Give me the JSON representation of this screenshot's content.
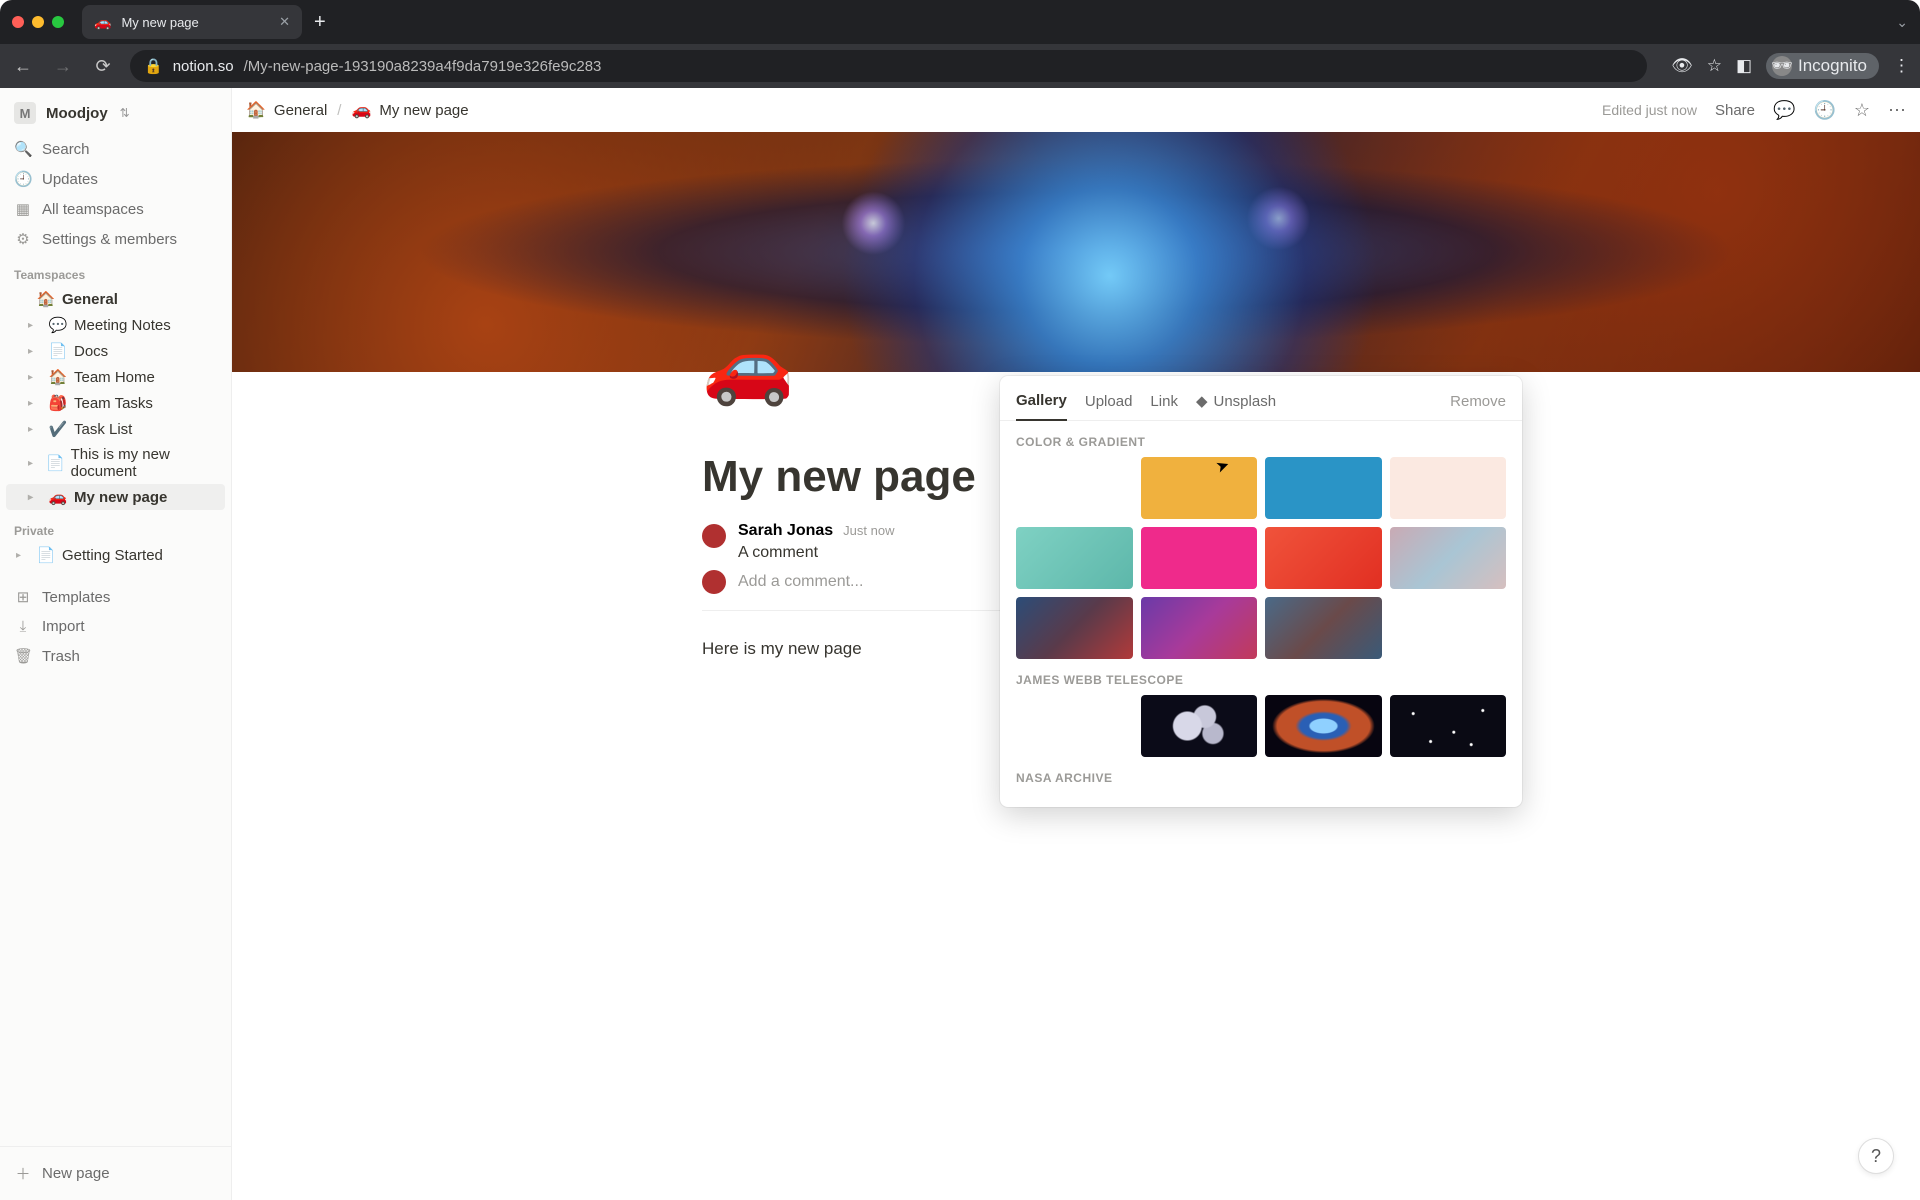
{
  "browser": {
    "tab_title": "My new page",
    "tab_icon": "🚗",
    "url_domain": "notion.so",
    "url_path": "/My-new-page-193190a8239a4f9da7919e326fe9c283",
    "incognito_label": "Incognito"
  },
  "workspace": {
    "initial": "M",
    "name": "Moodjoy"
  },
  "sidebar": {
    "top": [
      {
        "label": "Search",
        "icon": "🔍"
      },
      {
        "label": "Updates",
        "icon": "🕘"
      },
      {
        "label": "All teamspaces",
        "icon": "▦"
      },
      {
        "label": "Settings & members",
        "icon": "⚙"
      }
    ],
    "section_teamspaces": "Teamspaces",
    "general_label": "General",
    "general_emoji": "🏠",
    "pages": [
      {
        "emoji": "💬",
        "label": "Meeting Notes"
      },
      {
        "emoji": "📄",
        "label": "Docs"
      },
      {
        "emoji": "🏠",
        "label": "Team Home"
      },
      {
        "emoji": "🎒",
        "label": "Team Tasks"
      },
      {
        "emoji": "✔️",
        "label": "Task List"
      },
      {
        "emoji": "📄",
        "label": "This is my new document"
      },
      {
        "emoji": "🚗",
        "label": "My new page",
        "active": true
      }
    ],
    "section_private": "Private",
    "private_pages": [
      {
        "emoji": "📄",
        "label": "Getting Started"
      }
    ],
    "bottom": [
      {
        "label": "Templates",
        "icon": "⊞"
      },
      {
        "label": "Import",
        "icon": "⤓"
      },
      {
        "label": "Trash",
        "icon": "🗑"
      }
    ],
    "new_page": "New page"
  },
  "topbar": {
    "crumbs": [
      {
        "emoji": "🏠",
        "label": "General"
      },
      {
        "emoji": "🚗",
        "label": "My new page"
      }
    ],
    "edited": "Edited just now",
    "share": "Share"
  },
  "page": {
    "icon": "🚗",
    "title": "My new page",
    "comment": {
      "author": "Sarah Jonas",
      "time": "Just now",
      "text": "A comment"
    },
    "add_comment_placeholder": "Add a comment...",
    "body": "Here is my new page"
  },
  "cover_picker": {
    "tabs": {
      "gallery": "Gallery",
      "upload": "Upload",
      "link": "Link",
      "unsplash": "Unsplash",
      "remove": "Remove"
    },
    "section_color": "COLOR & GRADIENT",
    "swatches": [
      "#e75a5f",
      "#f0b13e",
      "#2a94c6",
      "#fbe9e1",
      "linear-gradient(135deg,#7fd1c3,#5db7aa)",
      "#ef2a8b",
      "linear-gradient(135deg,#f0533b,#e12f22)",
      "linear-gradient(135deg,#c9aab4,#a9c5d4,#d6bfbf)",
      "linear-gradient(135deg,#2c4d78,#5a3a4a,#b23a3a)",
      "linear-gradient(135deg,#6a3aa8,#a83a9a,#c23a5a)",
      "linear-gradient(135deg,#4a6a88,#6a4a4a,#3a5a78)"
    ],
    "section_jwst": "JAMES WEBB TELESCOPE",
    "section_nasa": "NASA ARCHIVE"
  },
  "help": "?"
}
